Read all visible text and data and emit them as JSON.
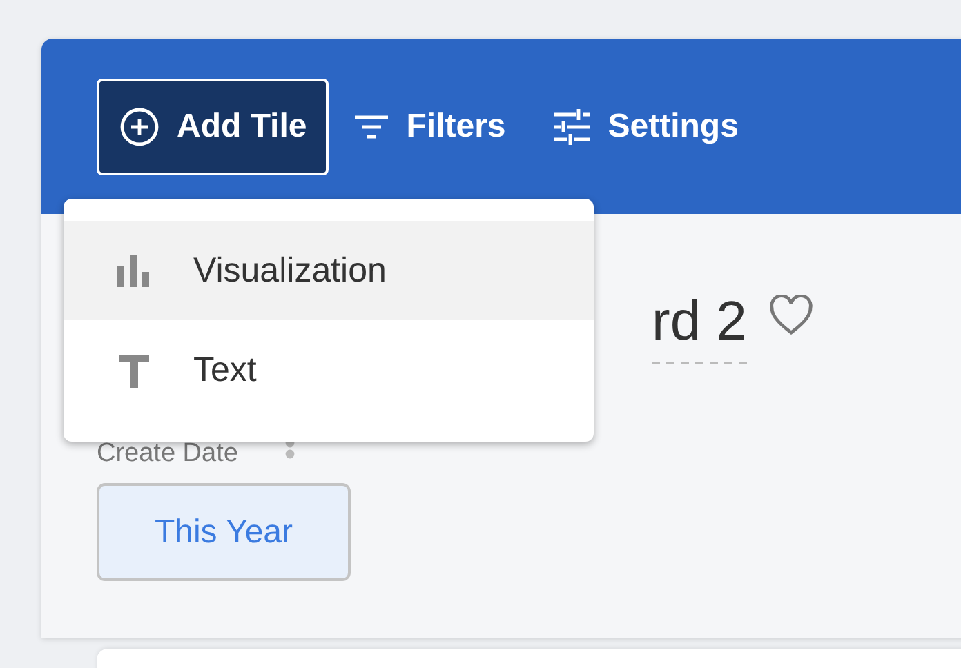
{
  "toolbar": {
    "buttons": [
      {
        "label": "Add Tile",
        "kind": "add",
        "selected": true
      },
      {
        "label": "Filters",
        "kind": "filters",
        "selected": false
      },
      {
        "label": "Settings",
        "kind": "settings",
        "selected": false
      }
    ]
  },
  "menu": {
    "items": [
      {
        "label": "Visualization",
        "kind": "chart",
        "selected": true
      },
      {
        "label": "Text",
        "kind": "text",
        "selected": false
      }
    ]
  },
  "dashboard": {
    "title": "rd 2",
    "favorite": false
  },
  "filter": {
    "label": "Create Date",
    "value": "This Year"
  }
}
